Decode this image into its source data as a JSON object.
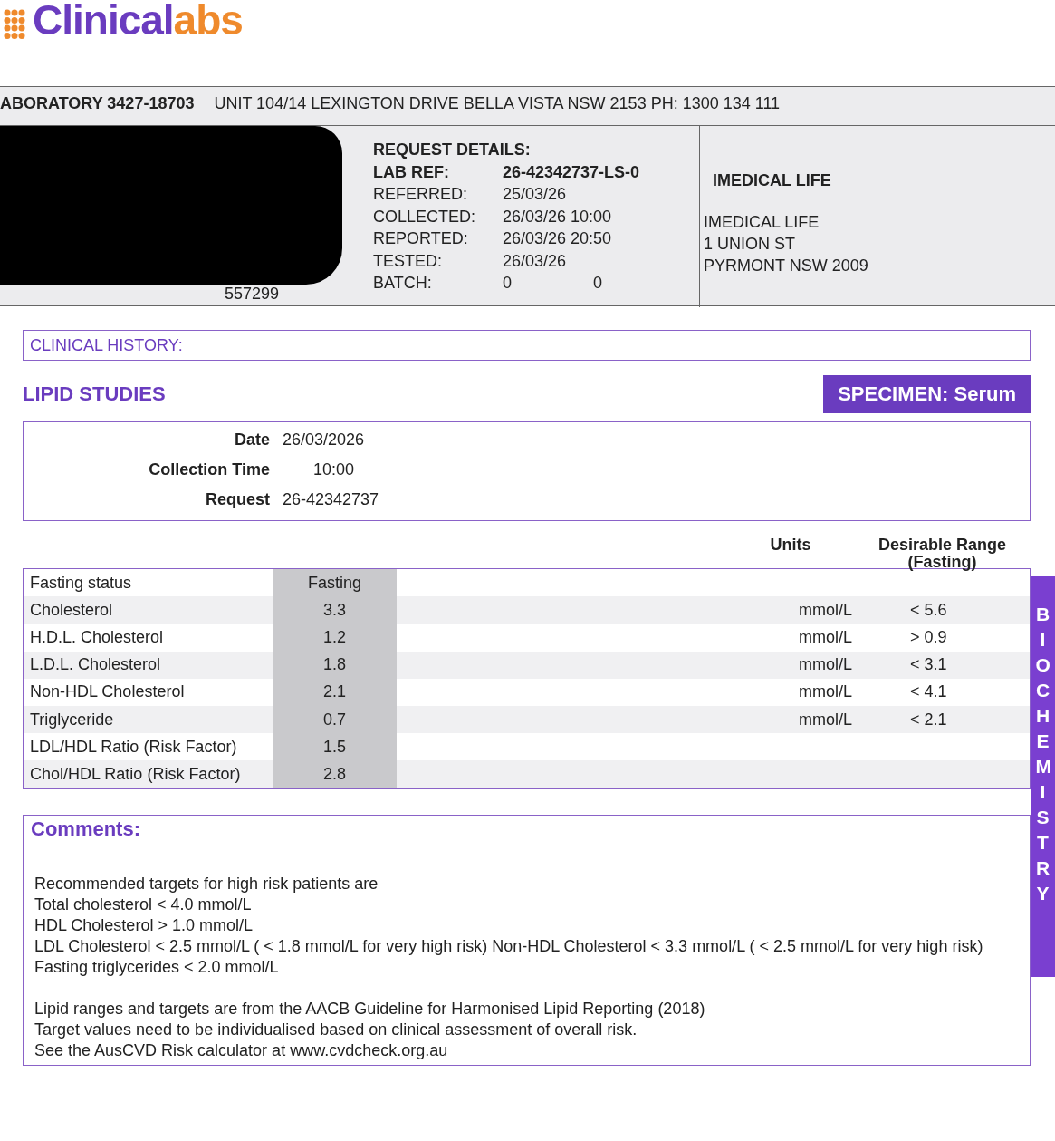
{
  "logo": {
    "part_1": "Clinical",
    "part_2": "abs"
  },
  "lab_bar": {
    "lab": "ABORATORY 3427-18703",
    "address": "UNIT 104/14 LEXINGTON DRIVE  BELLA VISTA  NSW  2153  PH: 1300 134 111"
  },
  "patient": {
    "visible_fragment": "557299"
  },
  "request_details": {
    "title": "REQUEST DETAILS:",
    "rows": [
      {
        "label": "LAB REF:",
        "value": "26-42342737-LS-0",
        "bold": true
      },
      {
        "label": "REFERRED:",
        "value": "25/03/26",
        "bold": false
      },
      {
        "label": "COLLECTED:",
        "value": "26/03/26 10:00",
        "bold": false
      },
      {
        "label": "REPORTED:",
        "value": "26/03/26 20:50",
        "bold": false
      },
      {
        "label": "TESTED:",
        "value": "26/03/26",
        "bold": false
      },
      {
        "label": "BATCH:",
        "value": "0",
        "value_2": "0",
        "bold": false
      }
    ]
  },
  "recipient": {
    "title": "IMEDICAL LIFE",
    "lines": [
      "IMEDICAL LIFE",
      "1 UNION ST",
      "PYRMONT NSW 2009"
    ]
  },
  "clinical_history": "CLINICAL HISTORY:",
  "section_title": "LIPID STUDIES",
  "specimen": "SPECIMEN: Serum",
  "collection": [
    {
      "label": "Date",
      "value": "26/03/2026"
    },
    {
      "label": "Collection Time",
      "value": "10:00"
    },
    {
      "label": "Request",
      "value": "26-42342737"
    }
  ],
  "columns": {
    "units": "Units",
    "range": "Desirable Range (Fasting)"
  },
  "results": [
    {
      "name": "Fasting status",
      "value": "Fasting"
    },
    {
      "name": "Cholesterol",
      "value": "3.3",
      "units": "mmol/L",
      "range": "< 5.6"
    },
    {
      "name": "H.D.L. Cholesterol",
      "value": "1.2",
      "units": "mmol/L",
      "range": "> 0.9"
    },
    {
      "name": "L.D.L. Cholesterol",
      "value": "1.8",
      "units": "mmol/L",
      "range": "< 3.1"
    },
    {
      "name": "Non-HDL Cholesterol",
      "value": "2.1",
      "units": "mmol/L",
      "range": "< 4.1"
    },
    {
      "name": "Triglyceride",
      "value": "0.7",
      "units": "mmol/L",
      "range": "< 2.1"
    },
    {
      "name": "LDL/HDL Ratio (Risk Factor)",
      "value": "1.5"
    },
    {
      "name": "Chol/HDL Ratio (Risk Factor)",
      "value": "2.8"
    }
  ],
  "side_tab": "BIOCHEMISTRY",
  "comments": {
    "title": "Comments:",
    "paragraphs": [
      [
        "Recommended targets for high risk patients are",
        "Total cholesterol < 4.0 mmol/L",
        "HDL Cholesterol > 1.0 mmol/L",
        "LDL Cholesterol < 2.5 mmol/L ( < 1.8 mmol/L for very high risk) Non-HDL Cholesterol < 3.3 mmol/L ( < 2.5 mmol/L for very high risk) Fasting triglycerides < 2.0 mmol/L"
      ],
      [
        "Lipid ranges and targets are from the AACB Guideline for Harmonised Lipid Reporting (2018)",
        "Target values need to be individualised based on clinical assessment of overall risk.",
        "See the AusCVD Risk calculator at www.cvdcheck.org.au"
      ]
    ]
  }
}
